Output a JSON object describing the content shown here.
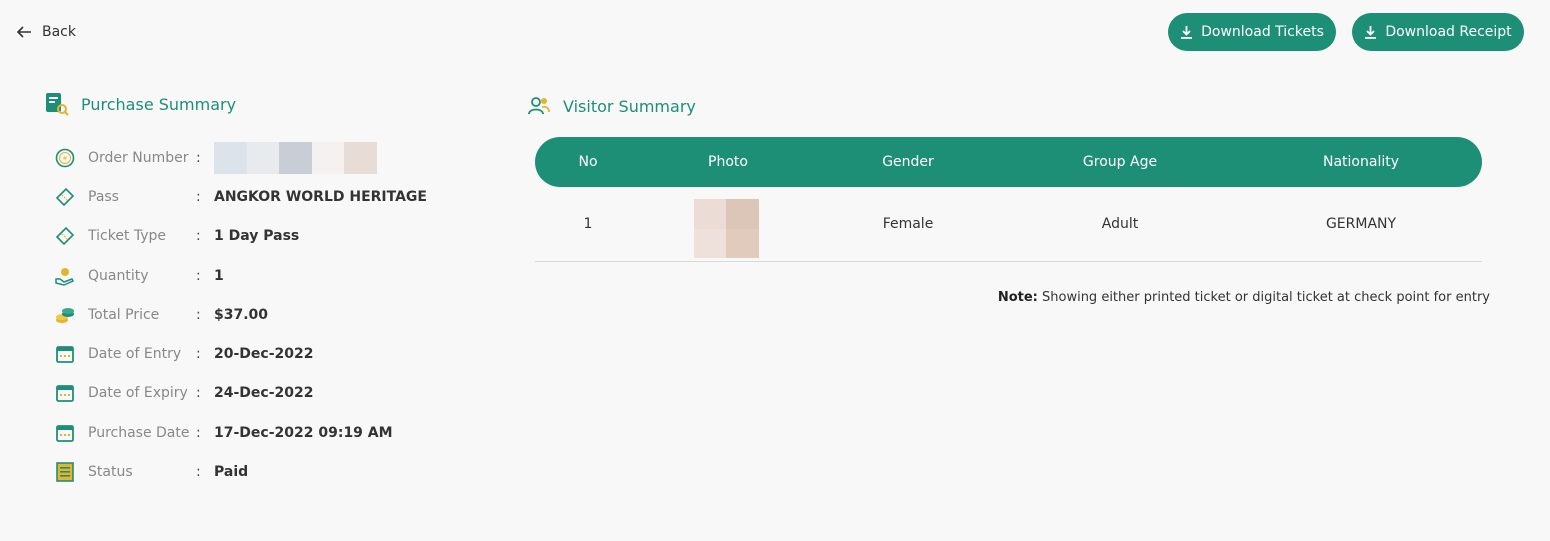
{
  "header": {
    "back_label": "Back",
    "download_tickets_label": "Download Tickets",
    "download_receipt_label": "Download Receipt"
  },
  "colors": {
    "accent": "#1e8f77",
    "icon_gold": "#e5b42c"
  },
  "purchase_summary": {
    "title": "Purchase Summary",
    "rows": [
      {
        "icon": "hash-circle-icon",
        "label": "Order Number",
        "value": ""
      },
      {
        "icon": "ticket-icon",
        "label": "Pass",
        "value": "ANGKOR WORLD HERITAGE"
      },
      {
        "icon": "ticket-icon",
        "label": "Ticket Type",
        "value": "1 Day Pass"
      },
      {
        "icon": "hand-coin-icon",
        "label": "Quantity",
        "value": "1"
      },
      {
        "icon": "coins-icon",
        "label": "Total Price",
        "value": "$37.00"
      },
      {
        "icon": "calendar-icon",
        "label": "Date of Entry",
        "value": "20-Dec-2022"
      },
      {
        "icon": "calendar-icon",
        "label": "Date of Expiry",
        "value": "24-Dec-2022"
      },
      {
        "icon": "calendar-icon",
        "label": "Purchase Date",
        "value": "17-Dec-2022 09:19 AM"
      },
      {
        "icon": "receipt-icon",
        "label": "Status",
        "value": "Paid"
      }
    ],
    "colon": ":"
  },
  "visitor_summary": {
    "title": "Visitor Summary",
    "columns": [
      "No",
      "Photo",
      "Gender",
      "Group Age",
      "Nationality"
    ],
    "rows": [
      {
        "no": "1",
        "gender": "Female",
        "group_age": "Adult",
        "nationality": "GERMANY"
      }
    ]
  },
  "note": {
    "label": "Note:",
    "text": " Showing either printed ticket or digital ticket at check point for entry"
  }
}
